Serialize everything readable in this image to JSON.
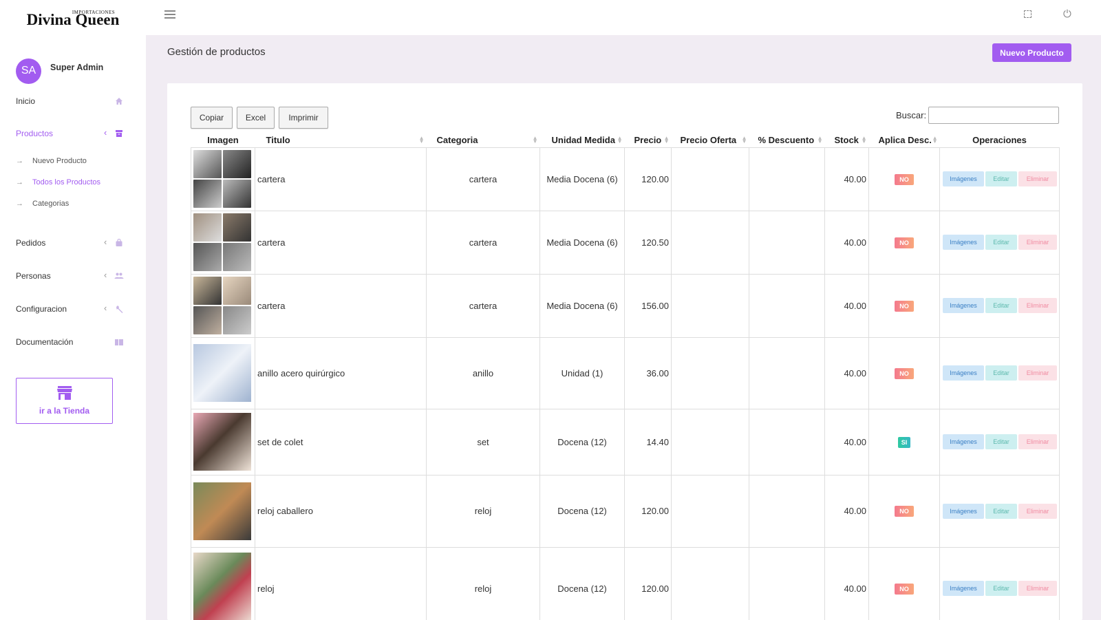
{
  "brand": {
    "small": "IMPORTACIONES",
    "main": "Divina Queen"
  },
  "user": {
    "initials": "SA",
    "name": "Super Admin"
  },
  "sidebar": {
    "items": [
      {
        "label": "Inicio",
        "icon": "home-icon"
      },
      {
        "label": "Productos",
        "icon": "archive-icon",
        "active": true
      },
      {
        "label": "Pedidos",
        "icon": "bag-icon"
      },
      {
        "label": "Personas",
        "icon": "people-icon"
      },
      {
        "label": "Configuracion",
        "icon": "wrench-icon"
      },
      {
        "label": "Documentación",
        "icon": "book-icon"
      }
    ],
    "subitems": [
      {
        "label": "Nuevo Producto"
      },
      {
        "label": "Todos los Productos",
        "active": true
      },
      {
        "label": "Categorias"
      }
    ],
    "store_button": "ir a la Tienda"
  },
  "header": {
    "title": "Gestión de productos",
    "new_button": "Nuevo Producto"
  },
  "toolbar": {
    "copy": "Copiar",
    "excel": "Excel",
    "print": "Imprimir",
    "search_label": "Buscar:",
    "search_value": ""
  },
  "table": {
    "columns": [
      "Imagen",
      "Titulo",
      "Categoria",
      "Unidad Medida",
      "Precio",
      "Precio Oferta",
      "% Descuento",
      "Stock",
      "Aplica Desc.",
      "Operaciones"
    ],
    "op_labels": {
      "images": "Imágenes",
      "edit": "Editar",
      "delete": "Eliminar"
    },
    "rows": [
      {
        "titulo": "cartera",
        "categoria": "cartera",
        "unidad": "Media Docena (6)",
        "precio": "120.00",
        "oferta": "",
        "descuento": "",
        "stock": "40.00",
        "aplica": "NO"
      },
      {
        "titulo": "cartera",
        "categoria": "cartera",
        "unidad": "Media Docena (6)",
        "precio": "120.50",
        "oferta": "",
        "descuento": "",
        "stock": "40.00",
        "aplica": "NO"
      },
      {
        "titulo": "cartera",
        "categoria": "cartera",
        "unidad": "Media Docena (6)",
        "precio": "156.00",
        "oferta": "",
        "descuento": "",
        "stock": "40.00",
        "aplica": "NO"
      },
      {
        "titulo": "anillo acero quirúrgico",
        "categoria": "anillo",
        "unidad": "Unidad (1)",
        "precio": "36.00",
        "oferta": "",
        "descuento": "",
        "stock": "40.00",
        "aplica": "NO"
      },
      {
        "titulo": "set de colet",
        "categoria": "set",
        "unidad": "Docena (12)",
        "precio": "14.40",
        "oferta": "",
        "descuento": "",
        "stock": "40.00",
        "aplica": "SI"
      },
      {
        "titulo": "reloj caballero",
        "categoria": "reloj",
        "unidad": "Docena (12)",
        "precio": "120.00",
        "oferta": "",
        "descuento": "",
        "stock": "40.00",
        "aplica": "NO"
      },
      {
        "titulo": "reloj",
        "categoria": "reloj",
        "unidad": "Docena (12)",
        "precio": "120.00",
        "oferta": "",
        "descuento": "",
        "stock": "40.00",
        "aplica": "NO"
      }
    ]
  },
  "colors": {
    "accent": "#a25cf0",
    "background": "#f1ecf3",
    "badge_no": "#f47a8d",
    "badge_si": "#2fc9a1"
  }
}
